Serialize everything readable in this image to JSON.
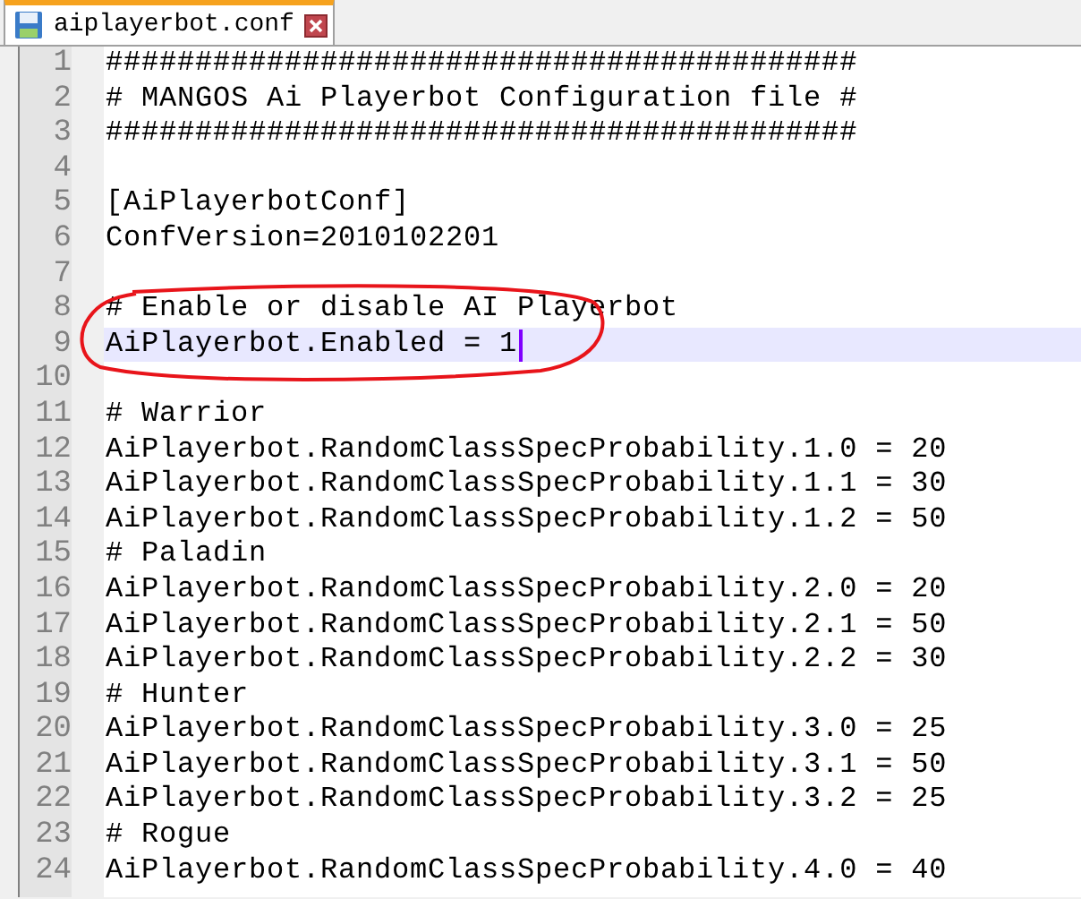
{
  "tabs": [
    {
      "label": "aiplayerbot.conf",
      "selected": true
    }
  ],
  "editor": {
    "lines": [
      {
        "number": "1",
        "text": "##########################################",
        "current": false
      },
      {
        "number": "2",
        "text": "# MANGOS Ai Playerbot Configuration file #",
        "current": false
      },
      {
        "number": "3",
        "text": "##########################################",
        "current": false
      },
      {
        "number": "4",
        "current": false
      },
      {
        "number": "5",
        "text": "[AiPlayerbotConf]",
        "current": false
      },
      {
        "number": "6",
        "text": "ConfVersion=2010102201",
        "current": false
      },
      {
        "number": "7",
        "current": false
      },
      {
        "number": "8",
        "text": "# Enable or disable AI Playerbot",
        "current": false
      },
      {
        "number": "9",
        "text": "AiPlayerbot.Enabled = 1",
        "current": true
      },
      {
        "number": "10",
        "current": false
      },
      {
        "number": "11",
        "text": "# Warrior",
        "current": false
      },
      {
        "number": "12",
        "text": "AiPlayerbot.RandomClassSpecProbability.1.0 = 20",
        "current": false
      },
      {
        "number": "13",
        "text": "AiPlayerbot.RandomClassSpecProbability.1.1 = 30",
        "current": false
      },
      {
        "number": "14",
        "text": "AiPlayerbot.RandomClassSpecProbability.1.2 = 50",
        "current": false
      },
      {
        "number": "15",
        "text": "# Paladin",
        "current": false
      },
      {
        "number": "16",
        "text": "AiPlayerbot.RandomClassSpecProbability.2.0 = 20",
        "current": false
      },
      {
        "number": "17",
        "text": "AiPlayerbot.RandomClassSpecProbability.2.1 = 50",
        "current": false
      },
      {
        "number": "18",
        "text": "AiPlayerbot.RandomClassSpecProbability.2.2 = 30",
        "current": false
      },
      {
        "number": "19",
        "text": "# Hunter",
        "current": false
      },
      {
        "number": "20",
        "text": "AiPlayerbot.RandomClassSpecProbability.3.0 = 25",
        "current": false
      },
      {
        "number": "21",
        "text": "AiPlayerbot.RandomClassSpecProbability.3.1 = 50",
        "current": false
      },
      {
        "number": "22",
        "text": "AiPlayerbot.RandomClassSpecProbability.3.2 = 25",
        "current": false
      },
      {
        "number": "23",
        "text": "# Rogue",
        "current": false
      },
      {
        "number": "24",
        "text": "AiPlayerbot.RandomClassSpecProbability.4.0 = 40",
        "current": false
      }
    ]
  }
}
